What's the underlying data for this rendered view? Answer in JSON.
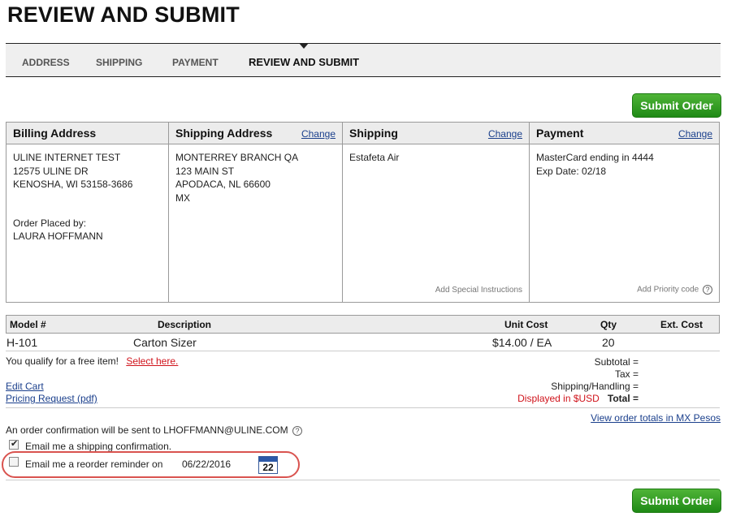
{
  "page": {
    "title": "REVIEW AND SUBMIT"
  },
  "steps": [
    {
      "label": "ADDRESS"
    },
    {
      "label": "SHIPPING"
    },
    {
      "label": "PAYMENT"
    },
    {
      "label": "REVIEW AND SUBMIT",
      "active": true
    }
  ],
  "submit_label": "Submit Order",
  "billing": {
    "title": "Billing Address",
    "lines": [
      "ULINE INTERNET TEST",
      "12575 ULINE DR",
      "KENOSHA, WI 53158-3686"
    ],
    "placed_by_label": "Order Placed by:",
    "placed_by": "LAURA HOFFMANN"
  },
  "shipping_address": {
    "title": "Shipping Address",
    "change": "Change",
    "lines": [
      "MONTERREY BRANCH QA",
      "123 MAIN ST",
      "APODACA, NL 66600",
      "MX"
    ]
  },
  "shipping": {
    "title": "Shipping",
    "change": "Change",
    "method": "Estafeta Air",
    "special_link": "Add Special Instructions"
  },
  "payment": {
    "title": "Payment",
    "change": "Change",
    "card": "MasterCard ending in 4444",
    "exp": "Exp Date: 02/18",
    "priority_link": "Add Priority code"
  },
  "table": {
    "headers": {
      "model": "Model #",
      "description": "Description",
      "unit_cost": "Unit Cost",
      "qty": "Qty",
      "ext_cost": "Ext. Cost"
    },
    "rows": [
      {
        "model": "H-101",
        "description": "Carton Sizer",
        "unit_cost": "$14.00 / EA",
        "qty": "20",
        "ext_cost": ""
      }
    ]
  },
  "free_item": {
    "text": "You qualify for a free item!",
    "link": "Select here."
  },
  "links": {
    "edit_cart": "Edit Cart",
    "pricing_request": "Pricing Request (pdf)"
  },
  "totals": {
    "subtotal": "Subtotal =",
    "tax": "Tax =",
    "shipping": "Shipping/Handling =",
    "displayed": "Displayed in $USD",
    "total": "Total ="
  },
  "view_totals_link": "View order totals in MX Pesos",
  "confirmation": {
    "text": "An order confirmation will be sent to LHOFFMANN@ULINE.COM"
  },
  "email_shipping": {
    "label": "Email me a shipping confirmation.",
    "checked": true
  },
  "email_reorder": {
    "label": "Email me a reorder reminder on",
    "date": "06/22/2016",
    "checked": false,
    "calendar_day": "22"
  }
}
